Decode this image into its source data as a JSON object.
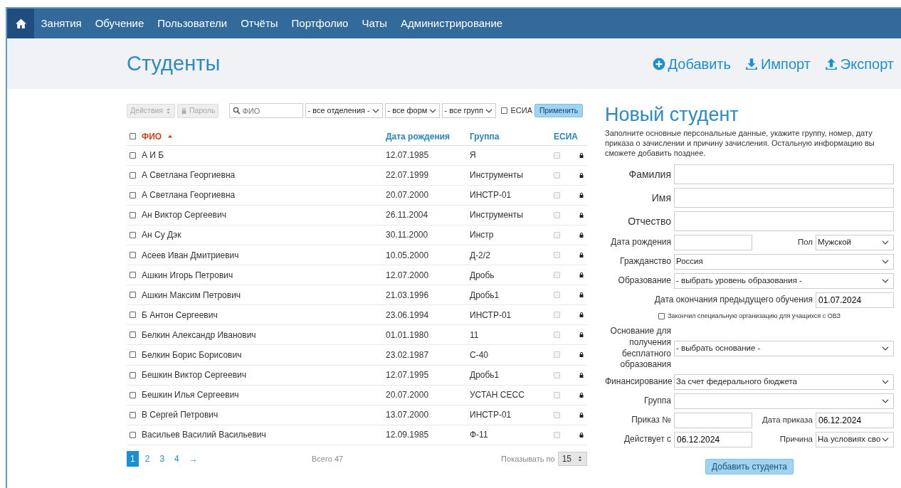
{
  "nav": {
    "home_selected": true,
    "items": [
      {
        "label": "Занятия",
        "selected": false
      },
      {
        "label": "Обучение",
        "selected": false
      },
      {
        "label": "Пользователи",
        "selected": false
      },
      {
        "label": "Отчёты",
        "selected": false
      },
      {
        "label": "Портфолио",
        "selected": false
      },
      {
        "label": "Чаты",
        "selected": false
      },
      {
        "label": "Администрирование",
        "selected": false
      }
    ]
  },
  "header": {
    "title": "Студенты",
    "actions": [
      {
        "kind": "add",
        "label": "Добавить"
      },
      {
        "kind": "import",
        "label": "Импорт"
      },
      {
        "kind": "export",
        "label": "Экспорт"
      }
    ]
  },
  "filters": {
    "actions_button": {
      "label": "Действия",
      "disabled": true
    },
    "password_button": {
      "label": "Пароль",
      "disabled": true
    },
    "search": {
      "placeholder": "ФИО"
    },
    "selects": [
      "- все отделения -",
      "- все форм",
      "- все групп"
    ],
    "esia": {
      "label": "ЕСИА",
      "checked": false
    },
    "apply_button": "Применить"
  },
  "table": {
    "select_all": false,
    "columns": [
      {
        "label": "ФИО",
        "sorted": true
      },
      {
        "label": "Дата рождения",
        "sorted": false
      },
      {
        "label": "Группа",
        "sorted": false
      },
      {
        "label": "ЕСИА",
        "sorted": false
      }
    ],
    "rows": [
      {
        "selected": false,
        "name": "А И Б",
        "birth": "12.07.1985",
        "group": "Я",
        "esia": false
      },
      {
        "selected": false,
        "name": "А Светлана Георгиевна",
        "birth": "22.07.1999",
        "group": "Инструменты",
        "esia": false
      },
      {
        "selected": false,
        "name": "А Светлана Георгиевна",
        "birth": "20.07.2000",
        "group": "ИНСТР-01",
        "esia": false
      },
      {
        "selected": false,
        "name": "Ан Виктор Сергеевич",
        "birth": "26.11.2004",
        "group": "Инструменты",
        "esia": false
      },
      {
        "selected": false,
        "name": "Ан Су Дэк",
        "birth": "30.11.2000",
        "group": "Инстр",
        "esia": false
      },
      {
        "selected": false,
        "name": "Асеев Иван Дмитриевич",
        "birth": "10.05.2000",
        "group": "Д-2/2",
        "esia": false
      },
      {
        "selected": false,
        "name": "Ашкин Игорь Петрович",
        "birth": "12.07.2000",
        "group": "Дробь",
        "esia": false
      },
      {
        "selected": false,
        "name": "Ашкин Максим Петрович",
        "birth": "21.03.1996",
        "group": "Дробь1",
        "esia": false
      },
      {
        "selected": false,
        "name": "Б Антон Сергеевич",
        "birth": "23.06.1994",
        "group": "ИНСТР-01",
        "esia": false
      },
      {
        "selected": false,
        "name": "Белкин Александр Иванович",
        "birth": "01.01.1980",
        "group": "11",
        "esia": false
      },
      {
        "selected": false,
        "name": "Белкин Борис Борисович",
        "birth": "23.02.1987",
        "group": "С-40",
        "esia": false
      },
      {
        "selected": false,
        "name": "Бешкин Виктор Сергеевич",
        "birth": "12.07.1995",
        "group": "Дробь1",
        "esia": false
      },
      {
        "selected": false,
        "name": "Бешкин Илья Сергеевич",
        "birth": "20.07.2000",
        "group": "УСТАН СЕСС",
        "esia": false
      },
      {
        "selected": false,
        "name": "В Сергей Петрович",
        "birth": "13.07.2000",
        "group": "ИНСТР-01",
        "esia": false
      },
      {
        "selected": false,
        "name": "Васильев Василий Васильевич",
        "birth": "12.09.1985",
        "group": "Ф-11",
        "esia": false
      }
    ]
  },
  "pagination": {
    "pages": [
      {
        "label": "1",
        "selected": true
      },
      {
        "label": "2",
        "selected": false
      },
      {
        "label": "3",
        "selected": false
      },
      {
        "label": "4",
        "selected": false
      },
      {
        "label": "→",
        "selected": false
      }
    ],
    "total": "Всего 47",
    "per_page_label": "Показывать по",
    "per_page": "15"
  },
  "form": {
    "title": "Новый студент",
    "intro": "Заполните основные персональные данные, укажите группу, номер, дату приказа о зачислении и причину зачисления. Остальную информацию вы сможете добавить позднее.",
    "rows": [
      {
        "kind": "large",
        "fields": [
          {
            "kind": "input",
            "label": "Фамилия"
          }
        ]
      },
      {
        "kind": "large",
        "fields": [
          {
            "kind": "input",
            "label": "Имя"
          }
        ]
      },
      {
        "kind": "large",
        "fields": [
          {
            "kind": "input",
            "label": "Отчество"
          }
        ]
      },
      {
        "kind": "pair",
        "fields": [
          {
            "kind": "input",
            "label": "Дата рождения"
          },
          {
            "kind": "select",
            "label": "Пол",
            "value": "Мужской"
          }
        ]
      },
      {
        "kind": "full",
        "fields": [
          {
            "kind": "select",
            "label": "Гражданство",
            "value": "Россия"
          }
        ]
      },
      {
        "kind": "full",
        "fields": [
          {
            "kind": "select",
            "label": "Образование",
            "value": "- выбрать уровень образования -"
          }
        ]
      },
      {
        "kind": "right",
        "fields": [
          {
            "kind": "input",
            "label": "Дата окончания предыдущего обучения",
            "value": "01.07.2024"
          }
        ]
      },
      {
        "kind": "checkbox",
        "label": "Закончил специальную организацию для учащихся с ОВЗ",
        "checked": false
      },
      {
        "kind": "full",
        "fields": [
          {
            "kind": "select",
            "label": "Основание для получения бесплатного образования",
            "value": "- выбрать основание -"
          }
        ]
      },
      {
        "kind": "full",
        "fields": [
          {
            "kind": "select",
            "label": "Финансирование",
            "value": "За счет федерального бюджета"
          }
        ]
      },
      {
        "kind": "full",
        "fields": [
          {
            "kind": "select",
            "label": "Группа"
          }
        ]
      },
      {
        "kind": "pair",
        "fields": [
          {
            "kind": "input",
            "label": "Приказ №"
          },
          {
            "kind": "input",
            "label": "Дата приказа",
            "value": "06.12.2024"
          }
        ]
      },
      {
        "kind": "pair",
        "fields": [
          {
            "kind": "input",
            "label": "Действует с",
            "value": "06.12.2024"
          },
          {
            "kind": "select",
            "label": "Причина",
            "value": "На условиях сво"
          }
        ]
      }
    ],
    "submit": "Добавить студента"
  }
}
